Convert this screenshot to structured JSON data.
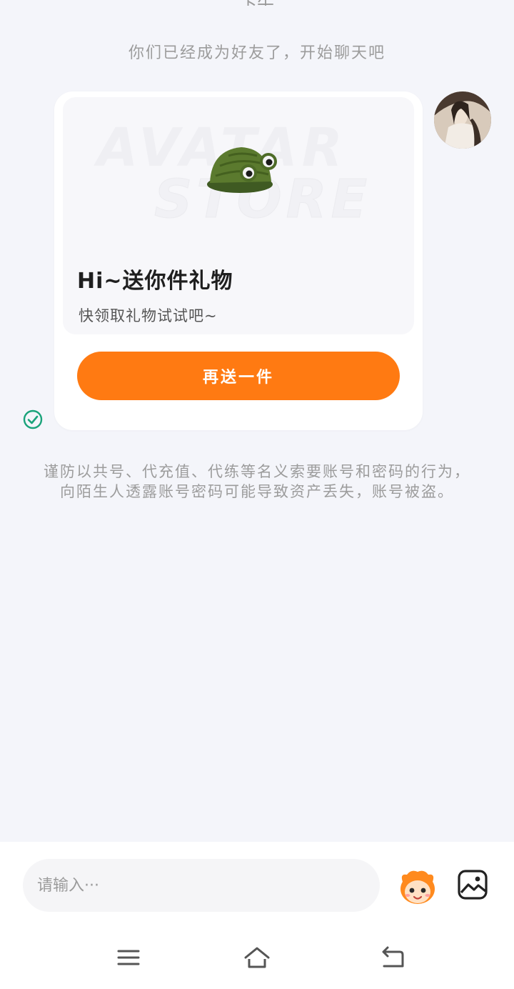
{
  "chat": {
    "top_partial_text": "下午",
    "system_message": "你们已经成为好友了，开始聊天吧",
    "gift_card": {
      "banner_watermark_line1": "AVATAR",
      "banner_watermark_line2": "STORE",
      "title": "Hi~送你件礼物",
      "subtitle": "快领取礼物试试吧~",
      "button_label": "再送一件"
    },
    "warning": "谨防以共号、代充值、代练等名义索要账号和密码的行为，向陌生人透露账号密码可能导致资产丢失，账号被盗。"
  },
  "input_bar": {
    "placeholder": "请输入···"
  },
  "colors": {
    "accent": "#ff7a12",
    "check": "#1aa37a",
    "background": "#f4f5fa"
  },
  "icons": {
    "status": "check-circle-icon",
    "emoji": "emoji-face-icon",
    "image": "image-icon",
    "menu": "menu-icon",
    "home": "home-icon",
    "back": "back-icon"
  }
}
